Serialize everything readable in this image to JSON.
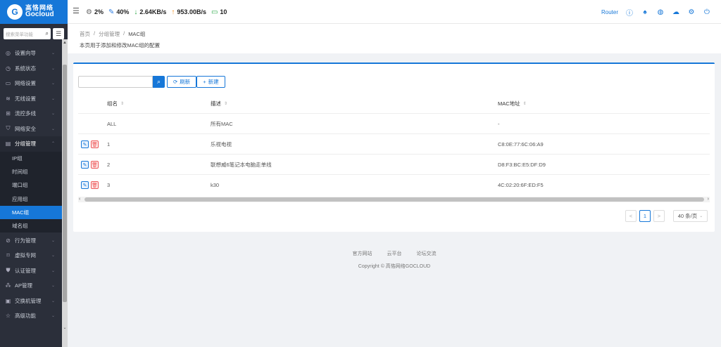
{
  "brand": {
    "name_cn": "高恪网络",
    "name_en": "Gocloud",
    "logo_icon": "cloud-logo-icon"
  },
  "status": {
    "cpu": "2%",
    "memory": "40%",
    "download": "2.64KB/s",
    "upload": "953.00B/s",
    "devices": "10"
  },
  "header_tools": {
    "router_label": "Router"
  },
  "sidebar": {
    "search_placeholder": "搜索菜单功能",
    "items": [
      {
        "label": "设置向导",
        "icon": "compass-icon"
      },
      {
        "label": "系统状态",
        "icon": "clock-icon"
      },
      {
        "label": "网络设置",
        "icon": "monitor-icon"
      },
      {
        "label": "无线设置",
        "icon": "wifi-icon"
      },
      {
        "label": "流控多线",
        "icon": "network-icon"
      },
      {
        "label": "网络安全",
        "icon": "shield-icon"
      },
      {
        "label": "分组管理",
        "icon": "document-icon"
      }
    ],
    "sub_items": [
      "IP组",
      "时间组",
      "端口组",
      "应用组",
      "MAC组",
      "域名组"
    ],
    "items_after": [
      {
        "label": "行为管理",
        "icon": "ban-icon"
      },
      {
        "label": "虚拟专网",
        "icon": "vpn-icon"
      },
      {
        "label": "认证管理",
        "icon": "shield-check-icon"
      },
      {
        "label": "AP管理",
        "icon": "ap-icon"
      },
      {
        "label": "交换机管理",
        "icon": "switch-icon"
      },
      {
        "label": "高级功能",
        "icon": "star-icon"
      }
    ]
  },
  "breadcrumb": {
    "home": "首页",
    "sep": "/",
    "parent": "分组管理",
    "current": "MAC组"
  },
  "page_desc": "本页用于添加和修改MAC组的配置",
  "toolbar": {
    "search_value": "",
    "refresh_label": "刷新",
    "new_label": "新建"
  },
  "table": {
    "headers": {
      "name": "组名",
      "desc": "描述",
      "mac": "MAC地址"
    },
    "rows": [
      {
        "name": "ALL",
        "desc": "所有MAC",
        "mac": "-",
        "editable": false
      },
      {
        "name": "1",
        "desc": "乐视电视",
        "mac": "C8:0E:77:6C:06:A9",
        "editable": true
      },
      {
        "name": "2",
        "desc": "联想威6笔记本电脑走单线",
        "mac": "D8:F3:BC:E5:DF:D9",
        "editable": true
      },
      {
        "name": "3",
        "desc": "k30",
        "mac": "4C:02:20:6F:ED:F5",
        "editable": true
      }
    ]
  },
  "pagination": {
    "prev": "<",
    "page": "1",
    "next": ">",
    "page_size": "40 条/页"
  },
  "footer": {
    "links": [
      "官方网站",
      "云平台",
      "论坛交流"
    ],
    "copyright": "Copyright © 高恪网络GOCLOUD"
  },
  "colors": {
    "accent": "#1677d8",
    "sidebar_bg": "#2b2f3a",
    "danger": "#e55555"
  }
}
